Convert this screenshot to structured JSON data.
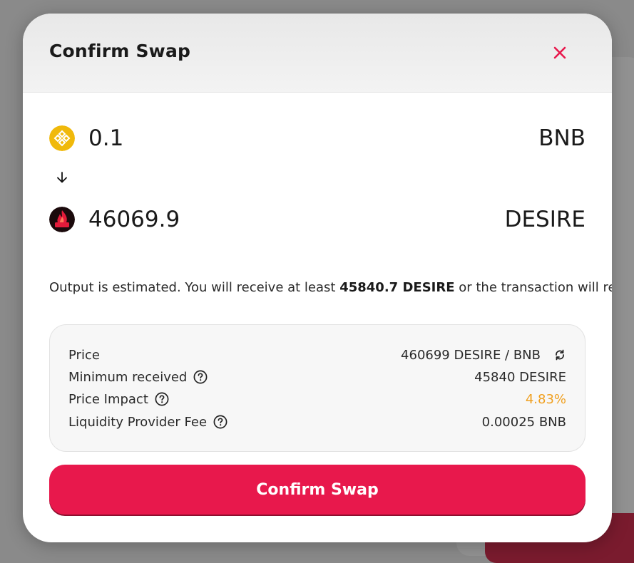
{
  "modal": {
    "title": "Confirm Swap",
    "close_icon": "close-icon"
  },
  "from_token": {
    "amount": "0.1",
    "symbol": "BNB",
    "icon": "bnb-logo-icon",
    "icon_color": "#F0B90B"
  },
  "to_token": {
    "amount": "46069.9",
    "symbol": "DESIRE",
    "icon": "desire-logo-icon"
  },
  "estimate": {
    "prefix": "Output is estimated. You will receive at least ",
    "amount": "45840.7 DESIRE",
    "suffix": " or the transaction will revert."
  },
  "details": {
    "price_label": "Price",
    "price_value": "460699 DESIRE / BNB",
    "min_received_label": "Minimum received",
    "min_received_value": "45840 DESIRE",
    "price_impact_label": "Price Impact",
    "price_impact_value": "4.83%",
    "lp_fee_label": "Liquidity Provider Fee",
    "lp_fee_value": "0.00025 BNB"
  },
  "confirm_button": "Confirm Swap",
  "colors": {
    "accent": "#E8184C",
    "warning": "#F0A020",
    "bnb": "#F0B90B"
  }
}
